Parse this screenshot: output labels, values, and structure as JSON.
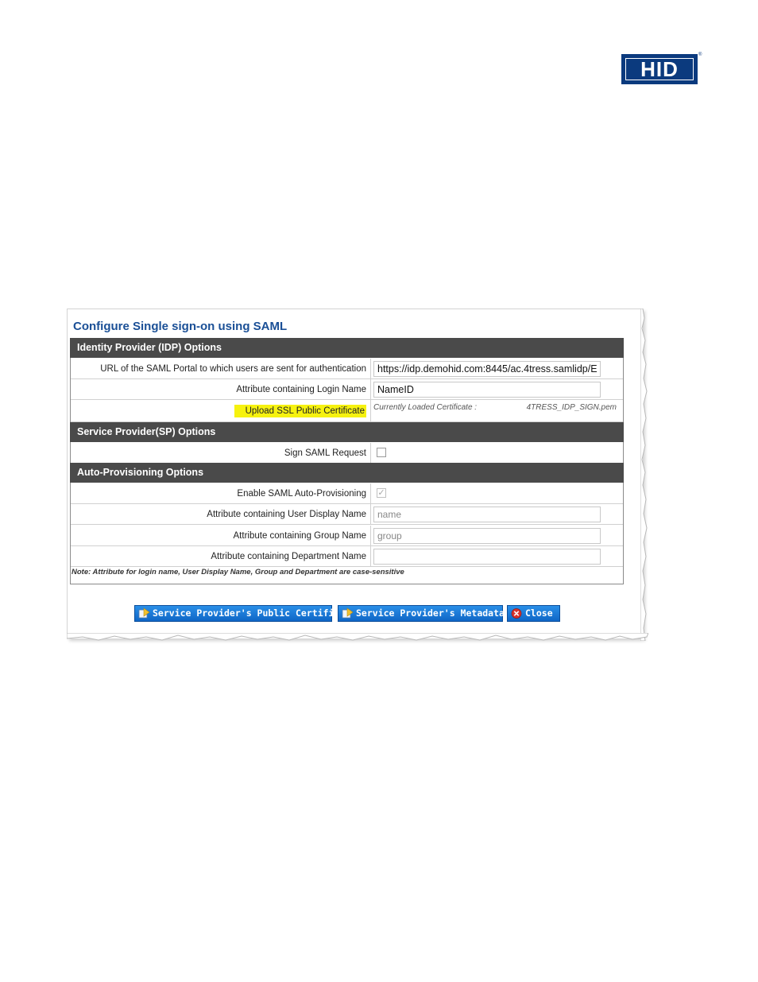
{
  "brand": {
    "logo_text": "HID",
    "registered_mark": "®",
    "brand_color": "#0b3a7e"
  },
  "page": {
    "title": "Configure Single sign-on using SAML",
    "accent_color": "#1a4f96"
  },
  "sections": {
    "idp": {
      "header": "Identity Provider (IDP) Options",
      "url_label": "URL of the SAML Portal to which users are sent for authentication",
      "url_value": "https://idp.demohid.com:8445/ac.4tress.samlidp/E",
      "login_attr_label": "Attribute containing Login Name",
      "login_attr_value": "NameID",
      "upload_label": "Upload SSL Public Certificate",
      "cert_label": "Currently Loaded Certificate :",
      "cert_file": "4TRESS_IDP_SIGN.pem"
    },
    "sp": {
      "header": "Service Provider(SP) Options",
      "sign_request_label": "Sign SAML Request",
      "sign_request_checked": false
    },
    "autoprov": {
      "header": "Auto-Provisioning Options",
      "enable_label": "Enable SAML Auto-Provisioning",
      "enable_checked": true,
      "display_name_label": "Attribute containing User Display Name",
      "display_name_placeholder": "name",
      "group_label": "Attribute containing Group Name",
      "group_placeholder": "group",
      "department_label": "Attribute containing Department Name",
      "department_value": ""
    }
  },
  "note": "Note: Attribute for login name, User Display Name, Group and Department are case-sensitive",
  "buttons": {
    "sp_certificate": "Service Provider's Public Certificate",
    "sp_metadata": "Service Provider's Metadata",
    "close": "Close"
  },
  "icons": {
    "sp_certificate": "certificate-export-icon",
    "sp_metadata": "metadata-export-icon",
    "close": "close-circle-icon"
  },
  "colors": {
    "section_header_bg": "#4a4a4a",
    "highlight": "#f6f20f",
    "button_blue": "#1577d8"
  }
}
